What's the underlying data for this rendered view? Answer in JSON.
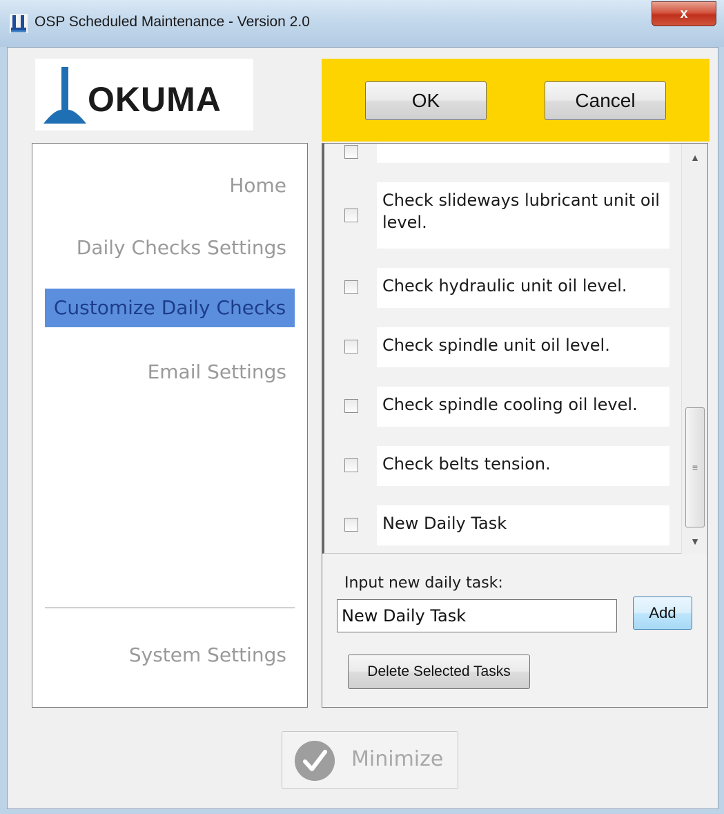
{
  "window": {
    "title": "OSP Scheduled Maintenance - Version 2.0",
    "close_label": "x"
  },
  "logo": {
    "text": "OKUMA",
    "brand_color": "#1f6fb5"
  },
  "actions": {
    "ok_label": "OK",
    "cancel_label": "Cancel",
    "accent_color": "#fdd400"
  },
  "nav": {
    "items": [
      {
        "label": "Home",
        "active": false
      },
      {
        "label": "Daily Checks Settings",
        "active": false
      },
      {
        "label": "Customize Daily Checks",
        "active": true
      },
      {
        "label": "Email Settings",
        "active": false
      }
    ],
    "system_label": "System Settings",
    "active_color": "#5b8fde"
  },
  "tasks": [
    {
      "label": "",
      "checked": false
    },
    {
      "label": "Check slideways lubricant unit oil level.",
      "checked": false
    },
    {
      "label": "Check hydraulic unit oil level.",
      "checked": false
    },
    {
      "label": "Check spindle unit oil level.",
      "checked": false
    },
    {
      "label": "Check spindle cooling oil level.",
      "checked": false
    },
    {
      "label": "Check belts tension.",
      "checked": false
    },
    {
      "label": "New Daily Task",
      "checked": false
    }
  ],
  "new_task": {
    "label": "Input new daily task:",
    "value": "New Daily Task",
    "add_label": "Add",
    "delete_label": "Delete Selected Tasks"
  },
  "footer": {
    "minimize_label": "Minimize"
  }
}
